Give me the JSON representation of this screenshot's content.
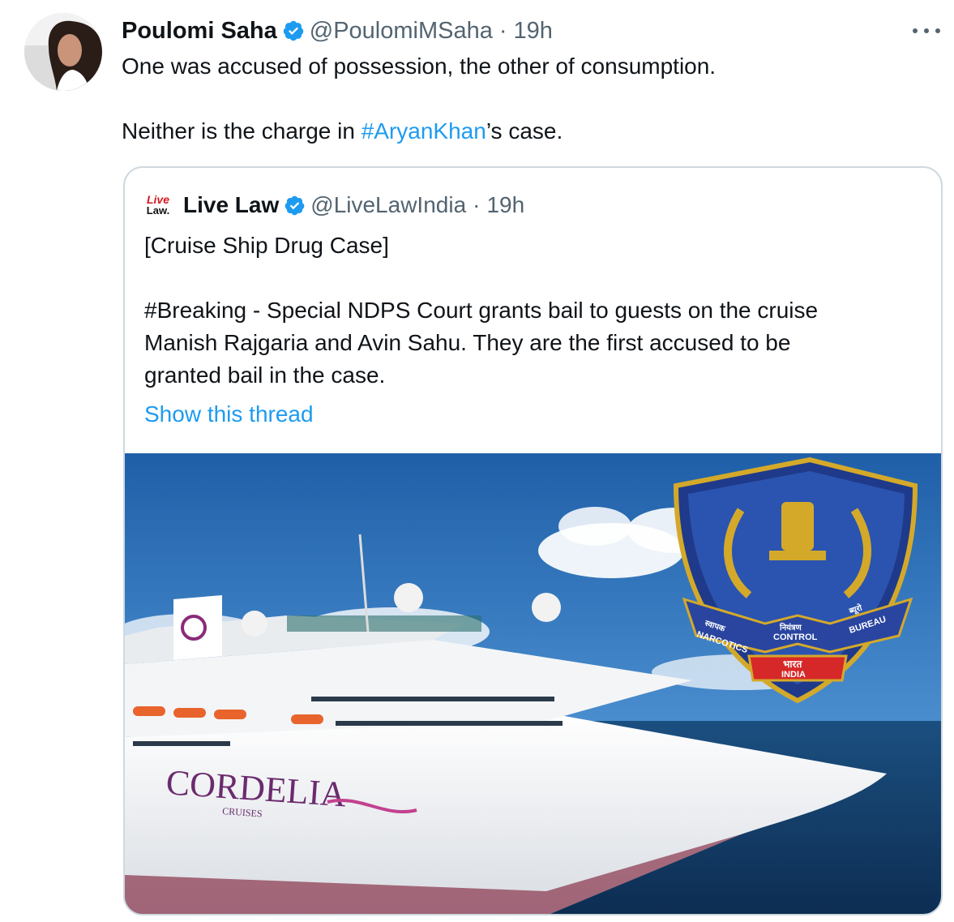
{
  "tweet": {
    "display_name": "Poulomi Saha",
    "handle": "@PoulomiMSaha",
    "separator": "·",
    "time": "19h",
    "text_line1": "One was accused of possession, the other of consumption.",
    "text_line2_before": "Neither is the charge in ",
    "text_line2_hashtag": "#AryanKhan",
    "text_line2_after": "’s case."
  },
  "quote": {
    "logo_line1": "Live",
    "logo_line2": "Law.",
    "display_name": "Live Law",
    "handle": "@LiveLawIndia",
    "separator": "·",
    "time": "19h",
    "line1": "[Cruise Ship Drug Case]",
    "line2": "#Breaking - Special NDPS Court grants bail to guests on the cruise",
    "line3": "Manish Rajgaria and Avin Sahu. They are the first accused to be",
    "line4": "granted bail in the case.",
    "show_thread": "Show this thread"
  },
  "media": {
    "ship_name": "CORDELIA",
    "ship_sub": "CRUISES",
    "emblem_banner_left": "NARCOTICS",
    "emblem_banner_center": "CONTROL",
    "emblem_banner_right": "BUREAU",
    "emblem_hindi_left": "स्वापक",
    "emblem_hindi_center": "नियंत्रण",
    "emblem_hindi_right": "ब्यूरो",
    "emblem_ribbon_hindi": "भारत",
    "emblem_ribbon": "INDIA"
  },
  "colors": {
    "link_blue": "#1d9bf0",
    "verified_blue": "#1d9bf0",
    "muted_gray": "#536471",
    "border": "#cfd9de"
  },
  "icons": {
    "verified": "verified-badge-icon",
    "more": "more-dots-icon"
  }
}
